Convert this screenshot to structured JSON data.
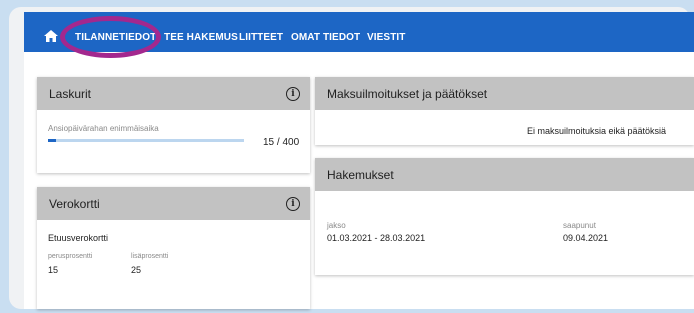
{
  "nav": {
    "items": [
      "TILANNETIEDOT",
      "TEE HAKEMUS",
      "LIITTEET",
      "OMAT TIEDOT",
      "VIESTIT"
    ]
  },
  "laskurit": {
    "title": "Laskurit",
    "label": "Ansiopäivärahan enimmäisaika",
    "progress_text": "15 / 400",
    "progress_fraction": 0.0375
  },
  "verokortti": {
    "title": "Verokortti",
    "subtitle": "Etuusverokortti",
    "col1_label": "perusprosentti",
    "col1_value": "15",
    "col2_label": "lisäprosentti",
    "col2_value": "25"
  },
  "maksu": {
    "title": "Maksuilmoitukset ja päätökset",
    "empty_text": "Ei maksuilmoituksia eikä päätöksiä"
  },
  "hakemukset": {
    "title": "Hakemukset",
    "col1_label": "jakso",
    "col1_value": "01.03.2021 - 28.03.2021",
    "col2_label": "saapunut",
    "col2_value": "09.04.2021"
  },
  "colors": {
    "nav_bg": "#1d66c5",
    "highlight": "#a3288e",
    "progress_fill": "#1d66c5",
    "progress_track": "#bcd6ef"
  },
  "icons": [
    "home-icon",
    "info-icon"
  ]
}
